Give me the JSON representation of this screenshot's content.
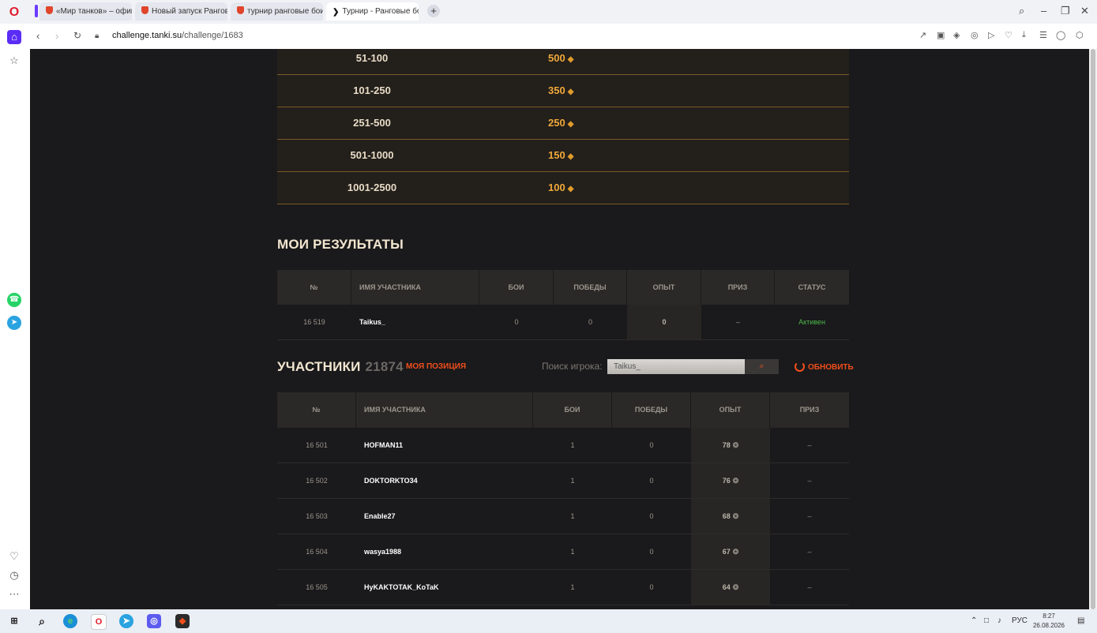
{
  "browser": {
    "tabs": [
      {
        "label": "«Мир танков» – официал"
      },
      {
        "label": "Новый запуск Ранговых"
      },
      {
        "label": "турнир ранговые бои - Р"
      },
      {
        "label": "Турнир - Ранговые бои."
      }
    ],
    "url_domain": "challenge.tanki.su",
    "url_path": "/challenge/1683"
  },
  "prizes": [
    {
      "rank": "51-100",
      "value": "500"
    },
    {
      "rank": "101-250",
      "value": "350"
    },
    {
      "rank": "251-500",
      "value": "250"
    },
    {
      "rank": "501-1000",
      "value": "150"
    },
    {
      "rank": "1001-2500",
      "value": "100"
    }
  ],
  "my_results": {
    "title": "МОИ РЕЗУЛЬТАТЫ",
    "headers": {
      "num": "№",
      "name": "ИМЯ УЧАСТНИКА",
      "battles": "БОИ",
      "wins": "ПОБЕДЫ",
      "exp": "ОПЫТ",
      "prize": "ПРИЗ",
      "status": "СТАТУС"
    },
    "row": {
      "num": "16 519",
      "name": "Taikus_",
      "battles": "0",
      "wins": "0",
      "exp": "0",
      "prize": "–",
      "status": "Активен"
    }
  },
  "participants": {
    "title": "УЧАСТНИКИ",
    "count": "21874",
    "my_position": "МОЯ ПОЗИЦИЯ",
    "search_label": "Поиск игрока:",
    "search_value": "Taikus_",
    "refresh_label": "ОБНОВИТЬ",
    "headers": {
      "num": "№",
      "name": "ИМЯ УЧАСТНИКА",
      "battles": "БОИ",
      "wins": "ПОБЕДЫ",
      "exp": "ОПЫТ",
      "prize": "ПРИЗ"
    },
    "rows": [
      {
        "num": "16 501",
        "name": "HOFMAN11",
        "battles": "1",
        "wins": "0",
        "exp": "78",
        "prize": "–"
      },
      {
        "num": "16 502",
        "name": "DOKTORKTO34",
        "battles": "1",
        "wins": "0",
        "exp": "76",
        "prize": "–"
      },
      {
        "num": "16 503",
        "name": "Enable27",
        "battles": "1",
        "wins": "0",
        "exp": "68",
        "prize": "–"
      },
      {
        "num": "16 504",
        "name": "wasya1988",
        "battles": "1",
        "wins": "0",
        "exp": "67",
        "prize": "–"
      },
      {
        "num": "16 505",
        "name": "HyKAKTOTAK_KoTaK",
        "battles": "1",
        "wins": "0",
        "exp": "64",
        "prize": "–"
      }
    ]
  },
  "taskbar": {
    "language": "РУС",
    "time": "8:27",
    "date": "26.08.2026"
  },
  "colors": {
    "page_bg": "#1a191b",
    "gold": "#f0a93a",
    "accent_orange": "#f04f1c",
    "status_green": "#4cb84a"
  }
}
